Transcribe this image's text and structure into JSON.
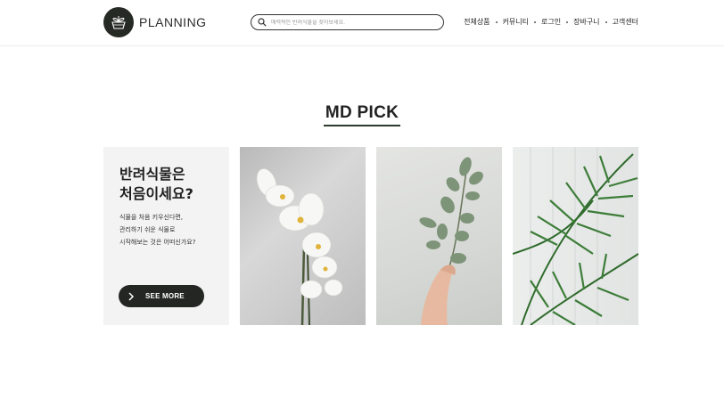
{
  "header": {
    "logo_text": "PLANNING",
    "search_placeholder": "매력적인 반려식물을 찾아보세요.",
    "nav": [
      "전체상품",
      "커뮤니티",
      "로그인",
      "장바구니",
      "고객센터"
    ]
  },
  "section": {
    "title": "MD PICK"
  },
  "intro": {
    "heading_line1": "반려식물은",
    "heading_line2": "처음이세요?",
    "desc": [
      "식물을 처음 키우신다면,",
      "관리하기 쉬운 식물로",
      "시작해보는 것은 어떠신가요?"
    ],
    "button_label": "SEE MORE"
  },
  "photos": [
    {
      "icon": "white-orchid-photo"
    },
    {
      "icon": "eucalyptus-branch-photo"
    },
    {
      "icon": "palm-leaves-photo"
    }
  ],
  "colors": {
    "accent_dark": "#232623",
    "intro_bg": "#f3f3f3"
  }
}
